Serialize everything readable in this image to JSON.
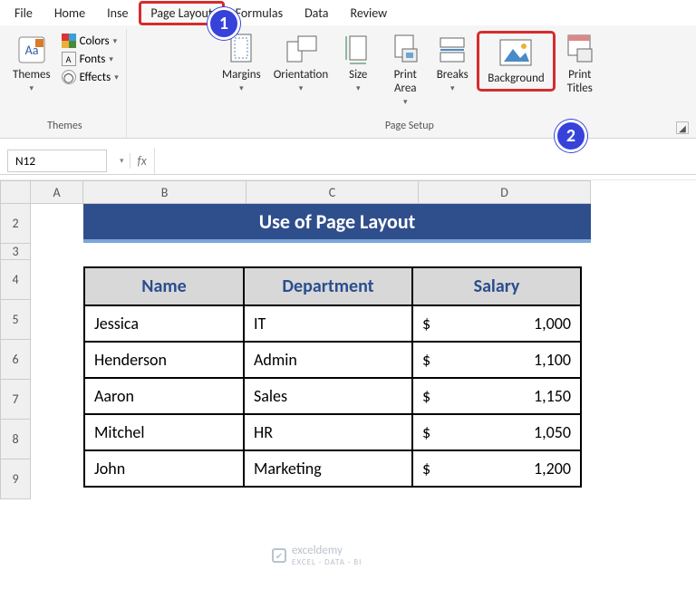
{
  "tabs": {
    "file": "File",
    "home": "Home",
    "insert": "Inse",
    "pagelayout": "Page Layout",
    "formulas": "Formulas",
    "data": "Data",
    "review": "Review"
  },
  "ribbon": {
    "themes": {
      "label": "Themes",
      "themes_btn": "Themes",
      "colors": "Colors",
      "fonts": "Fonts",
      "effects": "Effects"
    },
    "pagesetup": {
      "label": "Page Setup",
      "margins": "Margins",
      "orientation": "Orientation",
      "size": "Size",
      "printarea": "Print\nArea",
      "breaks": "Breaks",
      "background": "Background",
      "printtitles": "Print\nTitles"
    }
  },
  "annotations": {
    "one": "1",
    "two": "2"
  },
  "namebox": "N12",
  "fx_label": "fx",
  "cols": {
    "A": "A",
    "B": "B",
    "C": "C",
    "D": "D"
  },
  "rows": {
    "r2": "2",
    "r3": "3",
    "r4": "4",
    "r5": "5",
    "r6": "6",
    "r7": "7",
    "r8": "8",
    "r9": "9"
  },
  "title": "Use of Page Layout",
  "headers": {
    "name": "Name",
    "dept": "Department",
    "salary": "Salary"
  },
  "currency": "$",
  "data": {
    "r0": {
      "name": "Jessica",
      "dept": "IT",
      "salary": "1,000"
    },
    "r1": {
      "name": "Henderson",
      "dept": "Admin",
      "salary": "1,100"
    },
    "r2": {
      "name": "Aaron",
      "dept": "Sales",
      "salary": "1,150"
    },
    "r3": {
      "name": "Mitchel",
      "dept": "HR",
      "salary": "1,050"
    },
    "r4": {
      "name": "John",
      "dept": "Marketing",
      "salary": "1,200"
    }
  },
  "watermark": {
    "brand": "exceldemy",
    "tag": "EXCEL · DATA · BI"
  },
  "colw": {
    "A": 58,
    "B": 180,
    "C": 190,
    "D": 190
  },
  "rowh": {
    "2": 44,
    "3": 18,
    "4": 44,
    "5": 44,
    "6": 44,
    "7": 44,
    "8": 44,
    "9": 44
  }
}
